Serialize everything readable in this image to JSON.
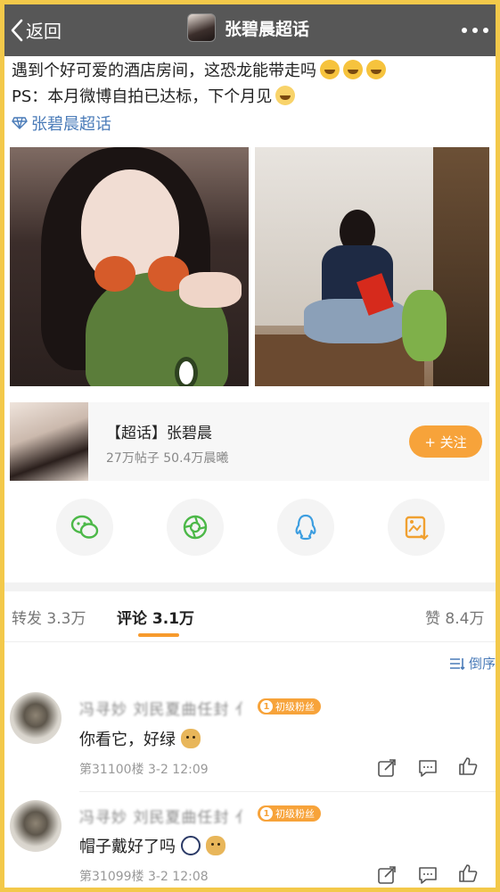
{
  "nav": {
    "back_label": "返回",
    "title": "张碧晨超话"
  },
  "post": {
    "line1": "遇到个好可爱的酒店房间，这恐龙能带走吗",
    "line2": "PS：本月微博自拍已达标，下个月见",
    "topic_link": "张碧晨超话"
  },
  "supertopic_card": {
    "title": "【超话】张碧晨",
    "stats": "27万帖子  50.4万晨曦",
    "follow_label": "+ 关注"
  },
  "share_icons": [
    "wechat-icon",
    "moments-icon",
    "qq-icon",
    "save-image-icon"
  ],
  "tabs": {
    "repost": "转发 3.3万",
    "comments": "评论 3.1万",
    "likes": "赞 8.4万"
  },
  "sort_label": "倒序",
  "comments": [
    {
      "username": "冯寻妙 刘民夏曲任封 亻",
      "badge_level": "1",
      "badge_label": "初级粉丝",
      "text": "你看它，好绿",
      "meta": "第31100楼  3-2 12:09"
    },
    {
      "username": "冯寻妙 刘民夏曲任封 亻",
      "badge_level": "1",
      "badge_label": "初级粉丝",
      "text": "帽子戴好了吗",
      "meta": "第31099楼  3-2 12:08"
    }
  ],
  "colors": {
    "accent_orange": "#f7a33a",
    "link_blue": "#4a7bb8",
    "nav_bg": "#575757",
    "frame_yellow": "#f3c94a"
  }
}
